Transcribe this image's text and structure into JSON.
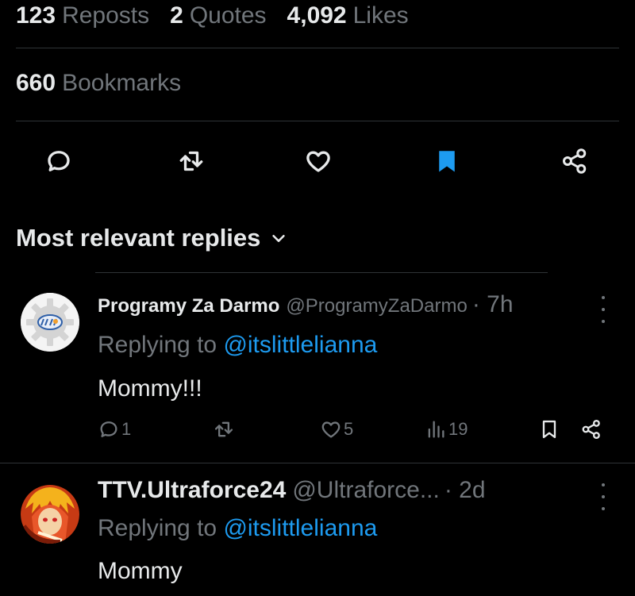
{
  "stats": {
    "reposts": {
      "count": "123",
      "label": "Reposts"
    },
    "quotes": {
      "count": "2",
      "label": "Quotes"
    },
    "likes": {
      "count": "4,092",
      "label": "Likes"
    },
    "bookmarks": {
      "count": "660",
      "label": "Bookmarks"
    }
  },
  "actions": {
    "icons": [
      "reply-icon",
      "repost-icon",
      "like-icon",
      "bookmark-icon",
      "share-icon"
    ],
    "bookmark_active_color": "#1d9bf0"
  },
  "replies_sort": {
    "label": "Most relevant replies"
  },
  "replies": [
    {
      "name": "Programy Za Darmo",
      "handle": "@ProgramyZaDarmo",
      "time": "· 7h",
      "replying_prefix": "Replying to",
      "replying_to": "@itslittlelianna",
      "text": "Mommy!!!",
      "reply_count": "1",
      "like_count": "5",
      "view_count": "19"
    },
    {
      "name": "TTV.Ultraforce24",
      "handle": "@Ultraforce...",
      "time": "· 2d",
      "replying_prefix": "Replying to",
      "replying_to": "@itslittlelianna",
      "text": "Mommy"
    }
  ],
  "colors": {
    "background": "#000000",
    "text": "#e7e9ea",
    "muted": "#71767b",
    "accent": "#1d9bf0",
    "divider": "#2f3336"
  }
}
